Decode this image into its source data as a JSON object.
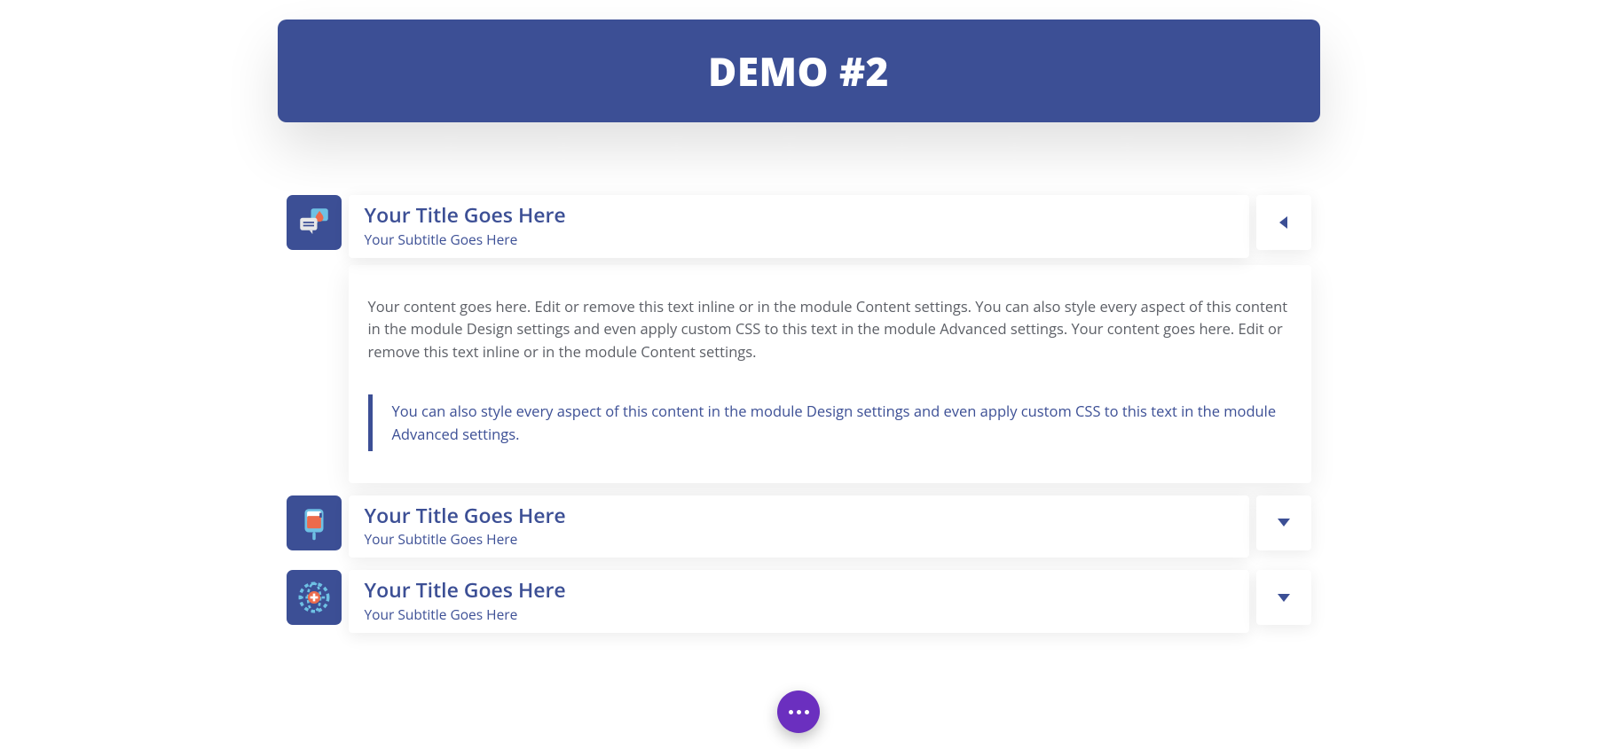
{
  "banner": {
    "title": "DEMO #2"
  },
  "accordion": [
    {
      "icon": "chat-drop-icon",
      "title": "Your Title Goes Here",
      "subtitle": "Your Subtitle Goes Here",
      "expanded": true,
      "body": "Your content goes here. Edit or remove this text inline or in the module Content settings. You can also style every aspect of this content in the module Design settings and even apply custom CSS to this text in the module Advanced settings. Your content goes here. Edit or remove this text inline or in the module Content settings.",
      "quote": "You can also style every aspect of this content in the module Design settings and even apply custom CSS to this text in the module Advanced settings."
    },
    {
      "icon": "iv-bag-icon",
      "title": "Your Title Goes Here",
      "subtitle": "Your Subtitle Goes Here",
      "expanded": false
    },
    {
      "icon": "globe-cross-icon",
      "title": "Your Title Goes Here",
      "subtitle": "Your Subtitle Goes Here",
      "expanded": false
    }
  ],
  "colors": {
    "primary": "#3c4f95",
    "fab": "#6b2fbf",
    "iconAccent": "#ec6b4c",
    "iconLight": "#6ec1e4"
  }
}
